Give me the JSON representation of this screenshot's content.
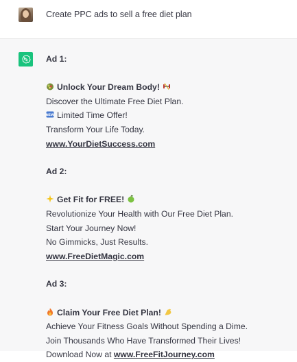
{
  "user_message": {
    "text": "Create PPC ads to sell a free diet plan"
  },
  "assistant_message": {
    "ads": [
      {
        "title": "Ad 1:",
        "headline": "Unlock Your Dream Body!",
        "headline_icon_before": "salad-icon",
        "headline_icon_after": "dumbbell-icon",
        "lines": [
          {
            "text": "Discover the Ultimate Free Diet Plan."
          },
          {
            "text": "Limited Time Offer!",
            "icon": "new-badge-icon"
          },
          {
            "text": "Transform Your Life Today."
          }
        ],
        "link_prefix": "",
        "link": "www.YourDietSuccess.com"
      },
      {
        "title": "Ad 2:",
        "headline": "Get Fit for FREE!",
        "headline_icon_before": "sparkles-icon",
        "headline_icon_after": "green-apple-icon",
        "lines": [
          {
            "text": "Revolutionize Your Health with Our Free Diet Plan."
          },
          {
            "text": "Start Your Journey Now!"
          },
          {
            "text": "No Gimmicks, Just Results."
          }
        ],
        "link_prefix": "",
        "link": "www.FreeDietMagic.com"
      },
      {
        "title": "Ad 3:",
        "headline": "Claim Your Free Diet Plan!",
        "headline_icon_before": "fire-icon",
        "headline_icon_after": "flexed-biceps-icon",
        "lines": [
          {
            "text": "Achieve Your Fitness Goals Without Spending a Dime."
          },
          {
            "text": "Join Thousands Who Have Transformed Their Lives!"
          }
        ],
        "link_prefix": "Download Now at ",
        "link": "www.FreeFitJourney.com"
      }
    ]
  },
  "colors": {
    "assistant_bg": "#f7f7f8",
    "gpt_green": "#19c37d",
    "text": "#343541"
  }
}
